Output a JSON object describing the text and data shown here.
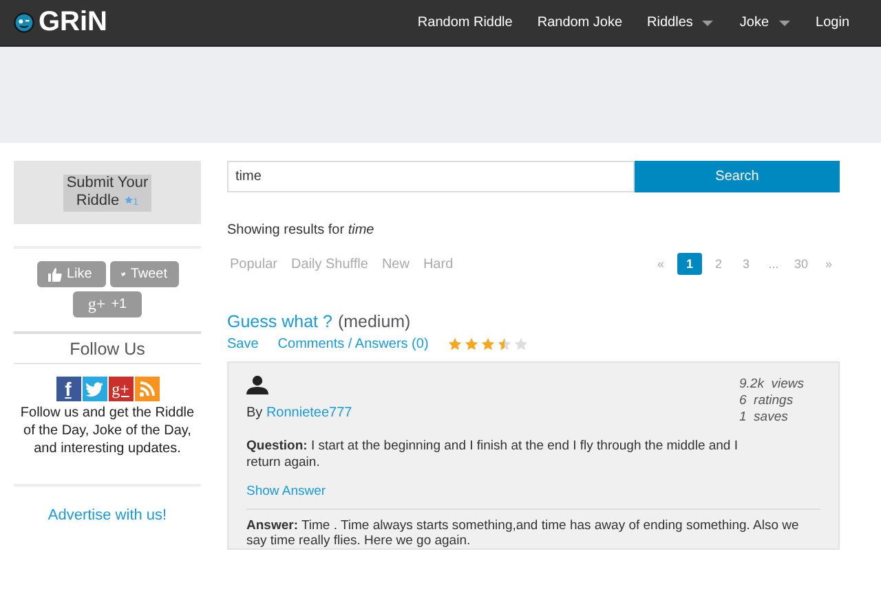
{
  "header": {
    "logo": "GRiN",
    "nav": [
      {
        "label": "Random Riddle",
        "dropdown": false
      },
      {
        "label": "Random Joke",
        "dropdown": false
      },
      {
        "label": "Riddles",
        "dropdown": true
      },
      {
        "label": "Joke",
        "dropdown": true
      },
      {
        "label": "Login",
        "dropdown": false
      }
    ]
  },
  "sidebar": {
    "submit": {
      "label": "Submit Your Riddle",
      "count": "1"
    },
    "share_buttons": [
      {
        "kind": "like",
        "label": "Like"
      },
      {
        "kind": "tweet",
        "label": "Tweet"
      },
      {
        "kind": "gplus",
        "glyph": "g+",
        "label": "+1"
      }
    ],
    "follow_title": "Follow Us",
    "follow_icons": [
      {
        "kind": "facebook",
        "glyph": "f",
        "color": "#3b5998"
      },
      {
        "kind": "twitter",
        "color": "#2aa9e0"
      },
      {
        "kind": "gplus",
        "glyph": "g+",
        "color": "#c9302c"
      },
      {
        "kind": "rss",
        "color": "#f7931e"
      }
    ],
    "follow_text": "Follow us and get the Riddle of the Day, Joke of the Day, and interesting updates.",
    "advertise": "Advertise with us!"
  },
  "search": {
    "value": "time",
    "button": "Search"
  },
  "results_info": "Showing results for *time*",
  "filters": [
    {
      "label": "Popular"
    },
    {
      "label": "Daily Shuffle"
    },
    {
      "label": "New"
    },
    {
      "label": "Hard"
    }
  ],
  "pagination": [
    {
      "label": "«",
      "selected": false
    },
    {
      "label": "1",
      "selected": true
    },
    {
      "label": "2",
      "selected": false
    },
    {
      "label": "3",
      "selected": false
    },
    {
      "label": "...",
      "selected": false
    },
    {
      "label": "30",
      "selected": false
    },
    {
      "label": "»",
      "selected": false
    }
  ],
  "riddle": {
    "title": "Guess what ?",
    "difficulty": "(medium)",
    "actions": [
      "Save",
      "Comments / Answers (0)"
    ],
    "stars": 3.5,
    "by": "By",
    "author": "Ronnietee777",
    "stats": [
      "9.2k  views",
      "6  ratings",
      "1  saves"
    ],
    "question": "**Question:** I start at the beginning and I finish at the end I fly through the middle and I return again.",
    "show_answer": "Show Answer",
    "answer": "**Answer:** Time . Time always starts something,and time has away of ending something. Also we say time really flies. Here we go again."
  }
}
